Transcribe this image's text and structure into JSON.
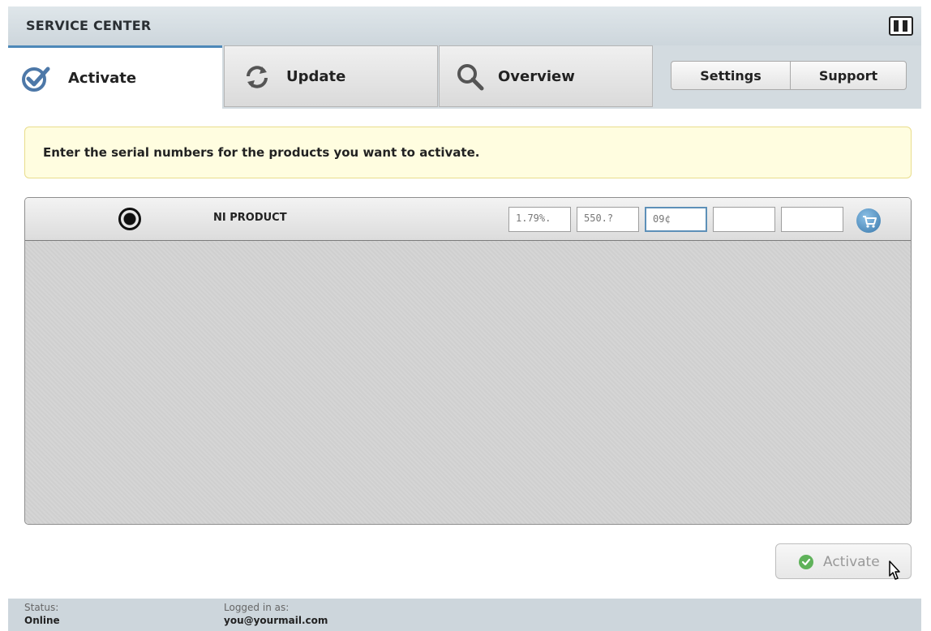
{
  "window": {
    "title": "SERVICE CENTER"
  },
  "tabs": [
    {
      "label": "Activate",
      "icon": "check-icon",
      "active": true
    },
    {
      "label": "Update",
      "icon": "refresh-icon",
      "active": false
    },
    {
      "label": "Overview",
      "icon": "magnifier-icon",
      "active": false
    }
  ],
  "header_buttons": {
    "settings": "Settings",
    "support": "Support"
  },
  "notice": {
    "text": "Enter the serial numbers for the products you want to activate."
  },
  "product": {
    "name": "NI PRODUCT",
    "serial_fields": [
      "1.79%.",
      "550.?",
      "09¢",
      "",
      ""
    ]
  },
  "actions": {
    "activate": "Activate"
  },
  "status": {
    "status_label": "Status:",
    "status_value": "Online",
    "login_label": "Logged in as:",
    "login_value": "you@yourmail.com"
  },
  "colors": {
    "accent": "#4d88b8",
    "notice_bg": "#fffde0",
    "statusbar": "#cdd6dc"
  }
}
